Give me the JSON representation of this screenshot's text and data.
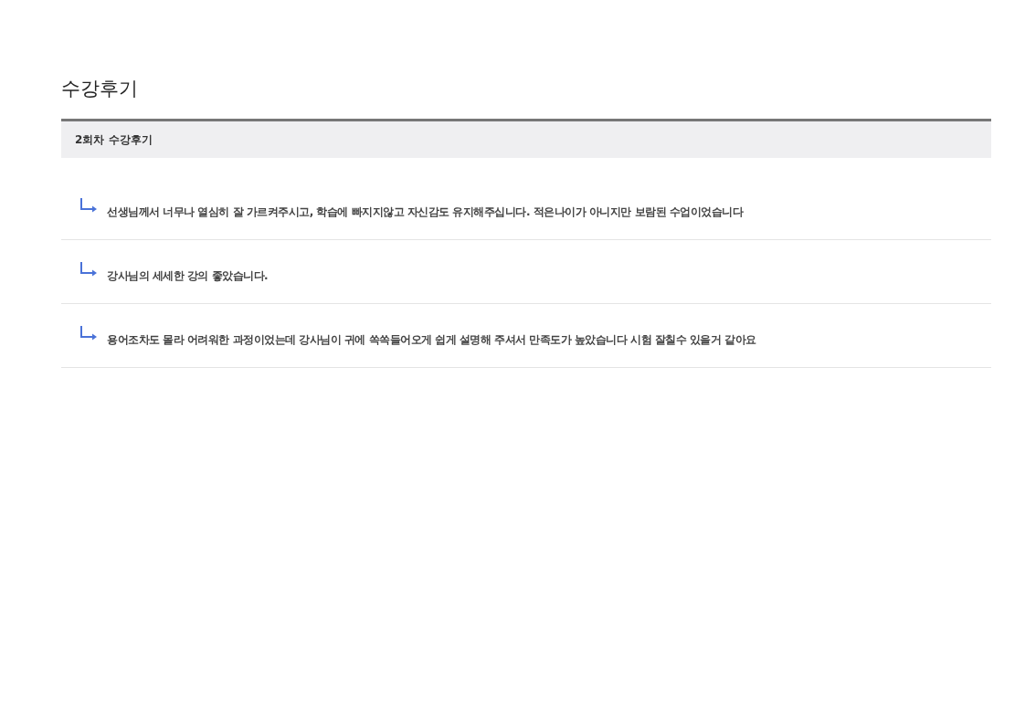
{
  "page_title": "수강후기",
  "section": {
    "title": "2회차 수강후기"
  },
  "reviews": [
    {
      "text": "선생님께서 너무나 열심히 잘 가르켜주시고, 학습에 빠지지않고 자신감도 유지해주십니다. 적은나이가 아니지만 보람된 수업이었습니다"
    },
    {
      "text": "강사님의 세세한 강의 좋았습니다."
    },
    {
      "text": "용어조차도 몰라 어려워한 과정이었는데 강사님이 귀에 쏙쏙들어오게 쉽게 설명해 주셔서 만족도가 높았습니다 시험 잘칠수 있을거 같아요"
    }
  ]
}
